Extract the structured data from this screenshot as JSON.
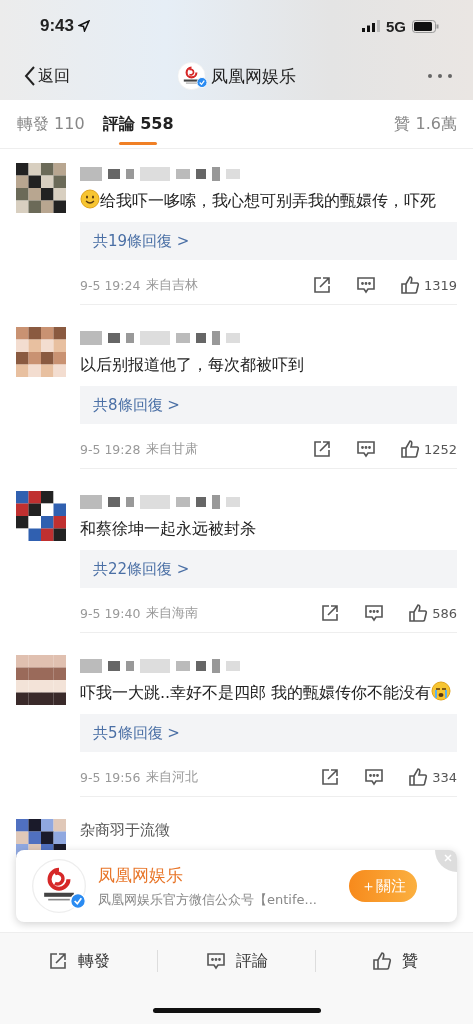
{
  "status_bar": {
    "time": "9:43",
    "network": "5G"
  },
  "nav": {
    "back": "返回",
    "title": "凤凰网娱乐",
    "verified": true
  },
  "tabs": [
    {
      "label": "轉發 110",
      "selected": false
    },
    {
      "label": "評論 558",
      "selected": true
    }
  ],
  "likes_total": "贊 1.6萬",
  "comments": [
    {
      "kind": "pixelated",
      "parts": [
        {
          "kind": "smile"
        },
        {
          "kind": "text",
          "text": "给我吓一哆嗦，我心想可别弄我的甄嬛传，吓死"
        }
      ],
      "replies": "共19條回復 >",
      "time": "9-5 19:24",
      "source": "来自吉林",
      "likes": "1319"
    },
    {
      "kind": "pixelated",
      "parts": [
        {
          "kind": "text",
          "text": "以后别报道他了，每次都被吓到"
        }
      ],
      "replies": "共8條回復 >",
      "time": "9-5 19:28",
      "source": "来自甘肃",
      "likes": "1252"
    },
    {
      "kind": "pixelated",
      "parts": [
        {
          "kind": "text",
          "text": "和蔡徐坤一起永远被封杀"
        }
      ],
      "replies": "共22條回復 >",
      "time": "9-5 19:40",
      "source": "来自海南",
      "likes": "586"
    },
    {
      "kind": "pixelated",
      "parts": [
        {
          "kind": "text",
          "text": "吓我一大跳..幸好不是四郎 我的甄嬛传你不能没有"
        },
        {
          "kind": "cry"
        }
      ],
      "replies": "共5條回復 >",
      "time": "9-5 19:56",
      "source": "来自河北",
      "likes": "334"
    },
    {
      "kind": "named",
      "name": "杂商羽于流徵"
    }
  ],
  "follow_card": {
    "name": "凤凰网娱乐",
    "description": "凤凰网娱乐官方微信公众号【entife...",
    "button": "＋關注",
    "verified": true
  },
  "bottom_bar": [
    {
      "kind": "repost",
      "label": "轉發"
    },
    {
      "kind": "comment",
      "label": "評論"
    },
    {
      "kind": "like",
      "label": "贊"
    }
  ]
}
